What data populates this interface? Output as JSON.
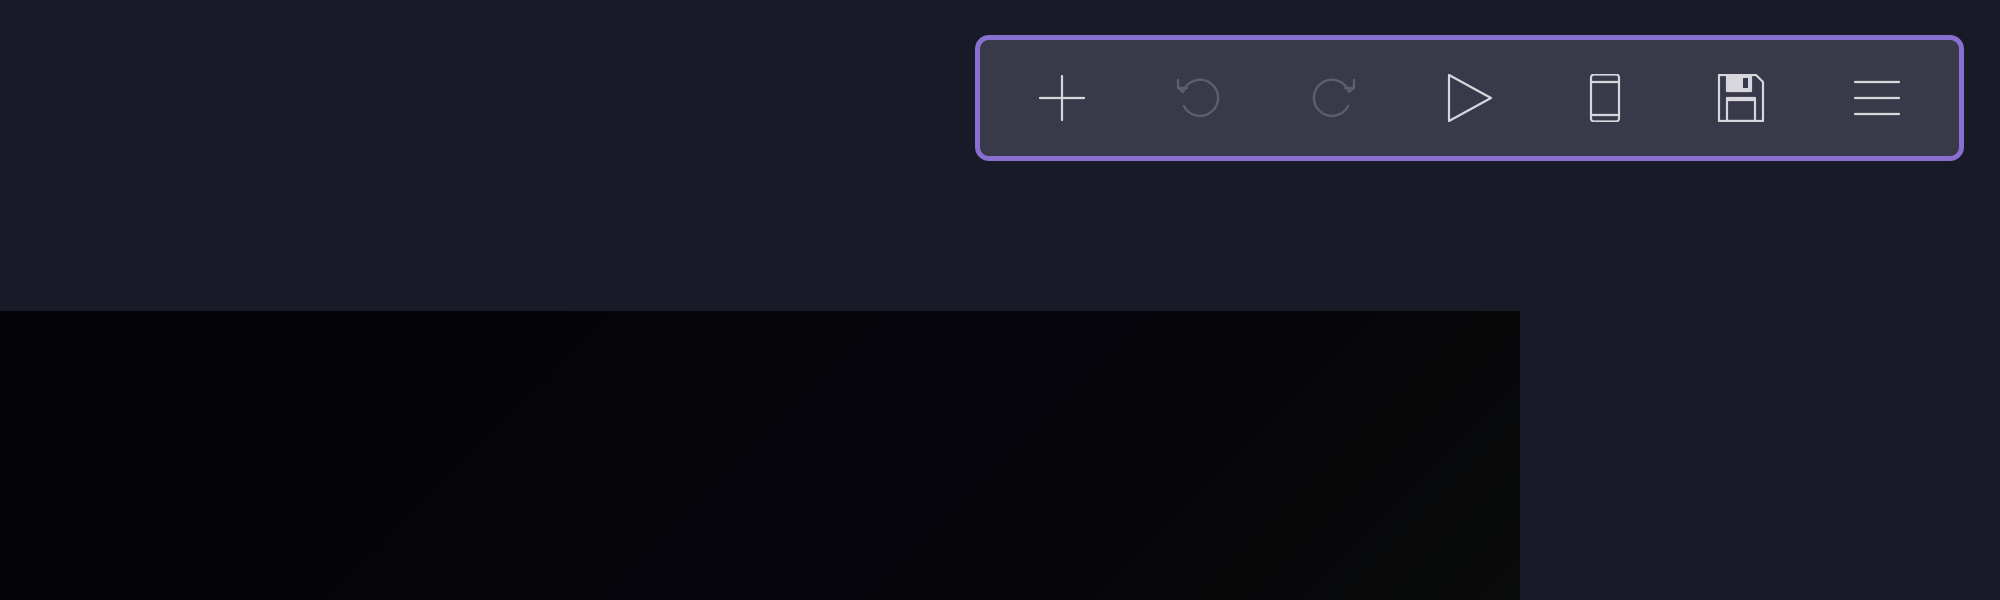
{
  "toolbar": {
    "items": [
      {
        "id": "add",
        "icon": "plus-icon",
        "enabled": true
      },
      {
        "id": "undo",
        "icon": "undo-icon",
        "enabled": false
      },
      {
        "id": "redo",
        "icon": "redo-icon",
        "enabled": false
      },
      {
        "id": "play",
        "icon": "play-icon",
        "enabled": true
      },
      {
        "id": "device",
        "icon": "phone-icon",
        "enabled": true
      },
      {
        "id": "save",
        "icon": "floppy-disk-icon",
        "enabled": true
      },
      {
        "id": "menu",
        "icon": "hamburger-menu-icon",
        "enabled": true
      }
    ],
    "colors": {
      "border": "#8a6fd2",
      "background": "#383949",
      "icon_enabled": "#d6d6dc",
      "icon_disabled": "#5d5e6c"
    }
  },
  "page": {
    "background": "#191a27",
    "canvas_background": "#040307"
  }
}
